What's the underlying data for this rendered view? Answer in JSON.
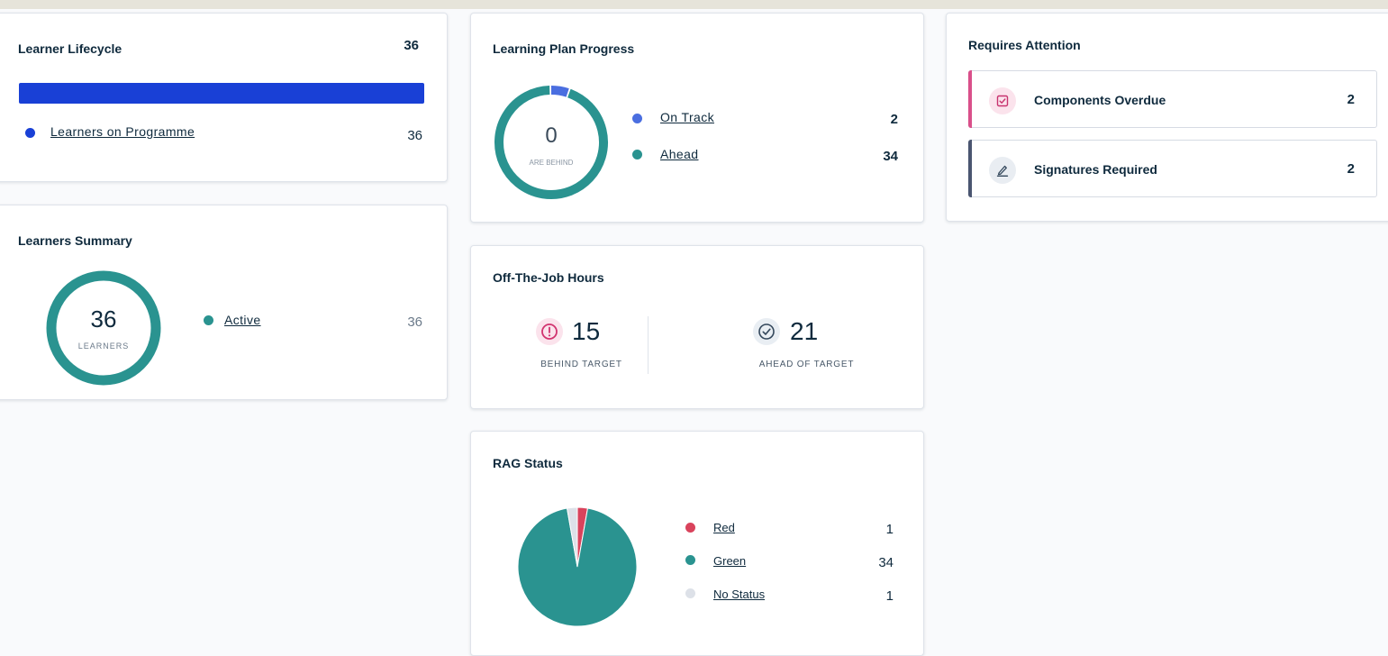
{
  "lifecycle": {
    "title": "Learner Lifecycle",
    "total": "36",
    "bar_color": "#1940d6",
    "legend": [
      {
        "label": "Learners on Programme",
        "value": "36",
        "color": "#1940d6"
      }
    ]
  },
  "summary": {
    "title": "Learners Summary",
    "center_value": "36",
    "center_label": "LEARNERS",
    "ring_color": "#2a9390",
    "legend": [
      {
        "label": "Active",
        "value": "36",
        "color": "#2a9390"
      }
    ]
  },
  "plan_progress": {
    "title": "Learning Plan Progress",
    "center_value": "0",
    "center_label": "ARE BEHIND",
    "legend": [
      {
        "label": "On Track",
        "value": "2",
        "color": "#4a6ee0"
      },
      {
        "label": "Ahead",
        "value": "34",
        "color": "#2a9390"
      }
    ]
  },
  "otj": {
    "title": "Off-The-Job Hours",
    "behind": {
      "value": "15",
      "label": "BEHIND TARGET",
      "icon": "alert-circle-icon",
      "color": "#d1336f"
    },
    "ahead": {
      "value": "21",
      "label": "AHEAD OF TARGET",
      "icon": "check-circle-icon",
      "color": "#33475b"
    }
  },
  "rag": {
    "title": "RAG Status",
    "legend": [
      {
        "label": "Red",
        "value": "1",
        "color": "#d9435c"
      },
      {
        "label": "Green",
        "value": "34",
        "color": "#2a9390"
      },
      {
        "label": "No Status",
        "value": "1",
        "color": "#dde1e8"
      }
    ]
  },
  "attention": {
    "title": "Requires Attention",
    "items": [
      {
        "label": "Components Overdue",
        "count": "2",
        "icon": "checkbox-icon",
        "accent": "#d94f8a"
      },
      {
        "label": "Signatures Required",
        "count": "2",
        "icon": "signature-pen-icon",
        "accent": "#4a5570"
      }
    ]
  },
  "chart_data": [
    {
      "type": "pie",
      "categories": [
        "Red",
        "Green",
        "No Status"
      ],
      "values": [
        1,
        34,
        1
      ],
      "colors": [
        "#d9435c",
        "#2a9390",
        "#dde1e8"
      ]
    },
    {
      "type": "pie",
      "categories": [
        "On Track",
        "Ahead"
      ],
      "values": [
        2,
        34
      ],
      "colors": [
        "#4a6ee0",
        "#2a9390"
      ]
    },
    {
      "type": "bar",
      "categories": [
        "Learners on Programme"
      ],
      "values": [
        36
      ]
    }
  ]
}
